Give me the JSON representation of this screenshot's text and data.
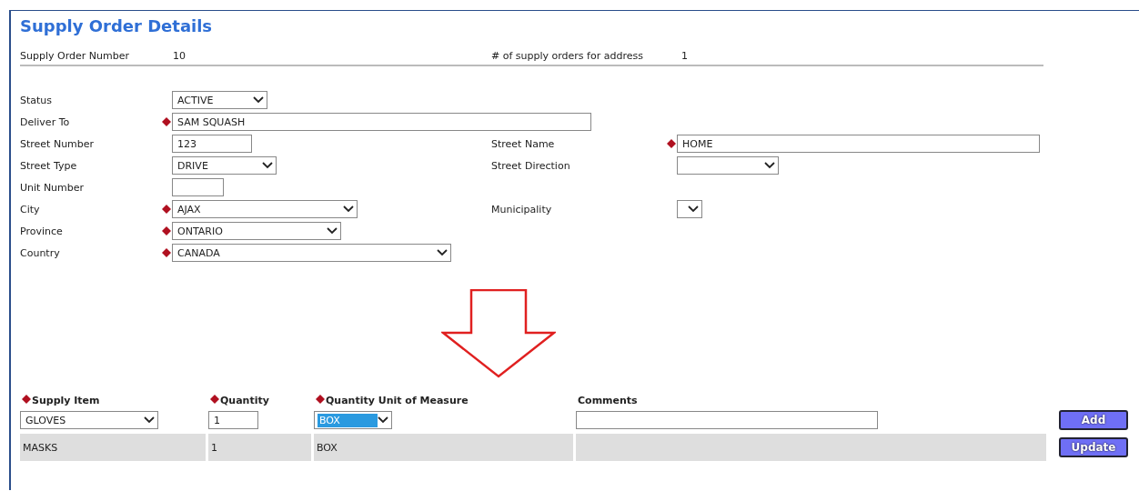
{
  "title": "Supply Order Details",
  "summary": [
    {
      "label": "Supply Order Number",
      "value": "10"
    },
    {
      "label": "# of supply orders for address",
      "value": "1"
    }
  ],
  "form_rows": [
    {
      "left": {
        "label": "Status",
        "kind": "select",
        "required": false,
        "value": "ACTIVE"
      }
    },
    {
      "left": {
        "label": "Deliver To",
        "kind": "text",
        "required": true,
        "value": "SAM SQUASH"
      }
    },
    {
      "left": {
        "label": "Street Number",
        "kind": "text",
        "required": false,
        "value": "123"
      },
      "right": {
        "label": "Street Name",
        "kind": "text",
        "required": true,
        "value": "HOME"
      }
    },
    {
      "left": {
        "label": "Street Type",
        "kind": "select",
        "required": false,
        "value": "DRIVE"
      },
      "right": {
        "label": "Street Direction",
        "kind": "select",
        "required": false
      }
    },
    {
      "left": {
        "label": "Unit Number",
        "kind": "text",
        "required": false
      }
    },
    {
      "left": {
        "label": "City",
        "kind": "select",
        "required": true,
        "value": "AJAX"
      },
      "right": {
        "label": "Municipality",
        "kind": "select",
        "required": false
      }
    },
    {
      "left": {
        "label": "Province",
        "kind": "select",
        "required": true,
        "value": "ONTARIO"
      }
    },
    {
      "left": {
        "label": "Country",
        "kind": "select",
        "required": true,
        "value": "CANADA"
      }
    }
  ],
  "items_table": {
    "columns": [
      {
        "label": "Supply Item",
        "required": true
      },
      {
        "label": "Quantity",
        "required": true
      },
      {
        "label": "Quantity Unit of Measure",
        "required": true
      },
      {
        "label": "Comments",
        "required": false
      }
    ],
    "entry": [
      {
        "kind": "select",
        "value": "GLOVES",
        "focused": false
      },
      {
        "kind": "text",
        "value": "1",
        "focused": false
      },
      {
        "kind": "select",
        "value": "BOX",
        "focused": true
      },
      {
        "kind": "text",
        "focused": false
      }
    ],
    "add_button": "Add",
    "rows": [
      {
        "cells": [
          "MASKS",
          "1",
          "BOX"
        ],
        "button": "Update"
      }
    ]
  }
}
